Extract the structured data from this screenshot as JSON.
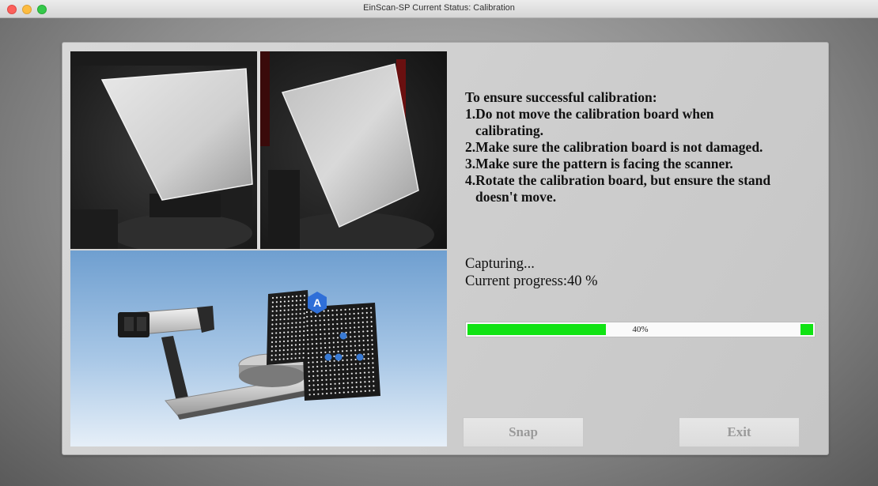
{
  "window": {
    "title": "EinScan-SP Current Status: Calibration"
  },
  "instructions": {
    "heading": "To ensure successful calibration:",
    "lines": [
      "1.Do not move the calibration board when",
      "calibrating.",
      "2.Make sure the calibration board is not damaged.",
      "3.Make sure the pattern is facing the scanner.",
      "4.Rotate the calibration board, but ensure the stand",
      "doesn't move."
    ]
  },
  "status": {
    "state": "Capturing...",
    "progress_text": "Current progress:40 %"
  },
  "progress": {
    "value": 0.4,
    "label": "40%",
    "color": "#10e313"
  },
  "illustration": {
    "badge_letter": "A"
  },
  "buttons": {
    "snap": "Snap",
    "exit": "Exit"
  },
  "colors": {
    "close": "#fc605b",
    "minimize": "#fdbc40",
    "maximize": "#34c84a",
    "sky": "#6f9fd0",
    "marker": "#3a7bd5"
  }
}
